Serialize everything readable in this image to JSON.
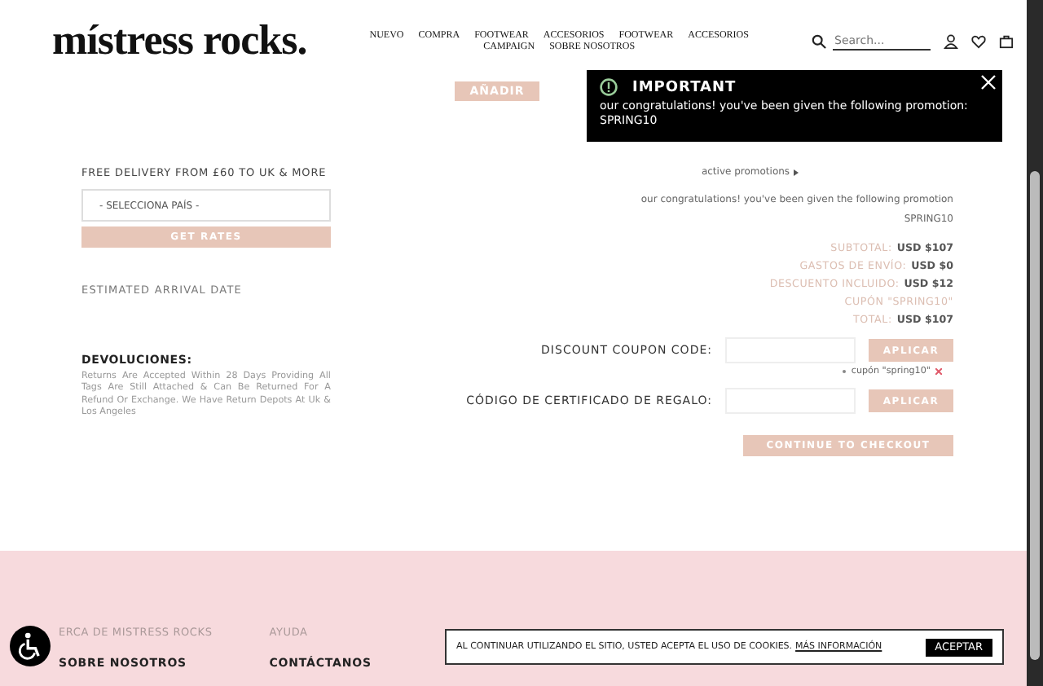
{
  "header": {
    "logo": "místress rocks.",
    "nav": [
      {
        "label": "NUEVO"
      },
      {
        "label": "COMPRA"
      },
      {
        "label": "FOOTWEAR"
      },
      {
        "label": "ACCESORIOS"
      },
      {
        "label": "FOOTWEAR"
      },
      {
        "label": "ACCESORIOS"
      },
      {
        "label": "CAMPAIGN"
      },
      {
        "label": "SOBRE NOSOTROS"
      }
    ],
    "search": {
      "placeholder": "Search..."
    }
  },
  "add_button": "AÑADIR",
  "toast": {
    "title": "IMPORTANT",
    "message": "our congratulations! you've been given the following promotion: SPRING10"
  },
  "shipping": {
    "heading": "FREE DELIVERY FROM £60 TO UK & MORE",
    "country_select": "- SELECCIONA PAÍS -",
    "get_rates": "GET RATES",
    "arrival": "ESTIMATED ARRIVAL DATE"
  },
  "returns": {
    "heading": "DEVOLUCIONES:",
    "text": "Returns Are Accepted Within 28 Days Providing All Tags Are Still Attached & Can Be Returned For A Refund Or Exchange. We Have Return Depots At Uk & Los Angeles"
  },
  "promotions": {
    "link": "active promotions",
    "message": "our congratulations! you've been given the following promotion",
    "code": "SPRING10"
  },
  "summary": [
    {
      "label": "SUBTOTAL:",
      "value": "USD $107"
    },
    {
      "label": "GASTOS DE ENVÍO:",
      "value": "USD $0"
    },
    {
      "label": "DESCUENTO INCLUIDO:",
      "value": "USD $12"
    },
    {
      "label": "CUPÓN \"SPRING10\""
    },
    {
      "label": "TOTAL:",
      "value": "USD $107"
    }
  ],
  "coupon": {
    "label": "DISCOUNT COUPON CODE:",
    "button": "APLICAR",
    "applied": "cupón \"spring10\""
  },
  "gift": {
    "label": "CÓDIGO DE CERTIFICADO DE REGALO:",
    "button": "APLICAR"
  },
  "checkout": "CONTINUE TO CHECKOUT",
  "footer": {
    "columns": [
      {
        "heading": "ERCA DE MISTRESS ROCKS",
        "link": "SOBRE NOSOTROS"
      },
      {
        "heading": "AYUDA",
        "link": "CONTÁCTANOS"
      }
    ]
  },
  "cookie": {
    "text": "AL CONTINUAR UTILIZANDO EL SITIO, USTED ACEPTA EL USO DE COOKIES.",
    "link": "MÁS INFORMACIÓN",
    "button": "ACEPTAR"
  }
}
